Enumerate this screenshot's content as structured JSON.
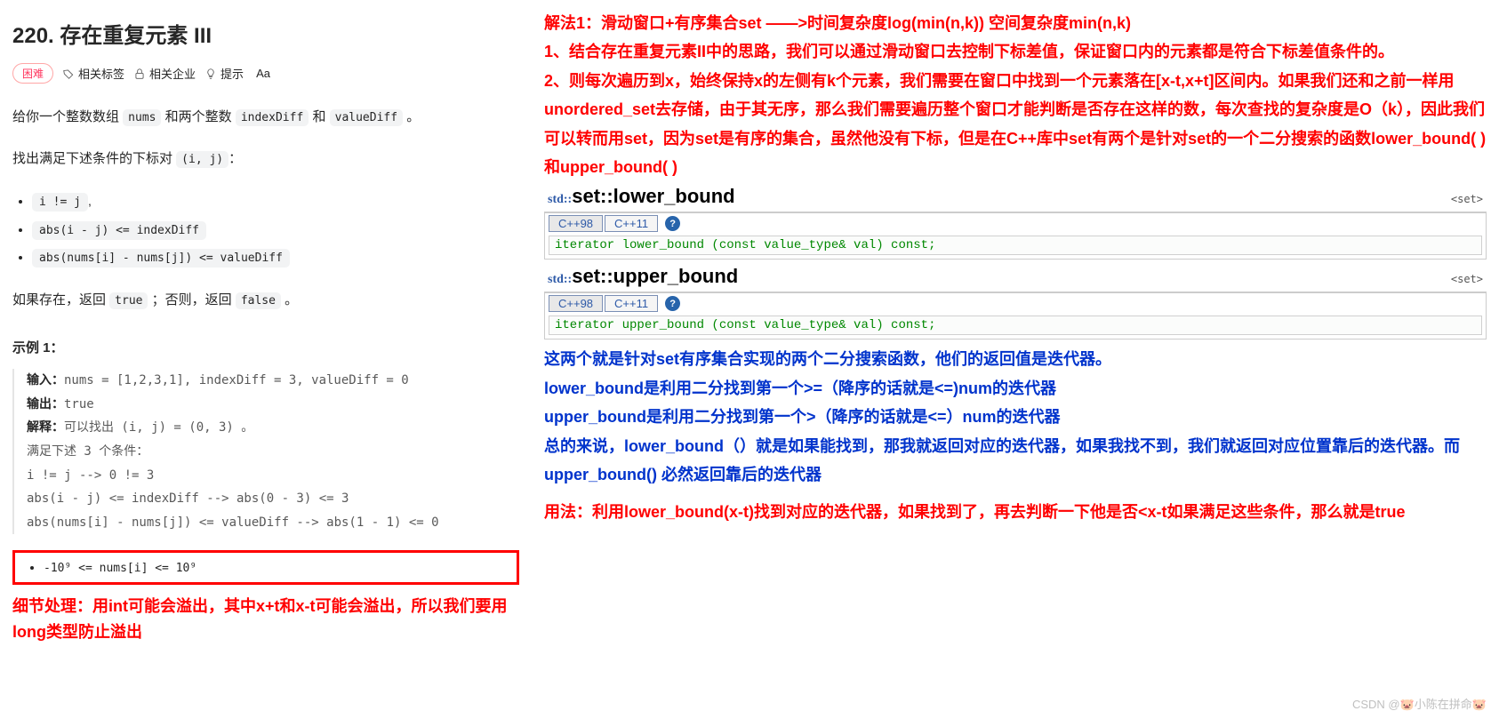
{
  "problem": {
    "title": "220. 存在重复元素 III",
    "difficulty": "困难",
    "meta": {
      "related_tags": "相关标签",
      "related_companies": "相关企业",
      "hint": "提示",
      "font_size": "Aa"
    },
    "desc_parts": {
      "p1_a": "给你一个整数数组 ",
      "nums": "nums",
      "p1_b": " 和两个整数 ",
      "indexDiff": "indexDiff",
      "p1_c": " 和 ",
      "valueDiff": "valueDiff",
      "p1_d": " 。",
      "p2_a": "找出满足下述条件的下标对 ",
      "ij": "(i, j)",
      "p2_b": "："
    },
    "conditions": {
      "c1": "i != j",
      "c1_tail": ",",
      "c2": "abs(i - j) <= indexDiff",
      "c3": "abs(nums[i] - nums[j]) <= valueDiff"
    },
    "return_line": {
      "a": "如果存在，返回 ",
      "true": "true",
      "b": " ；否则，返回 ",
      "false": "false",
      "c": " 。"
    },
    "example": {
      "heading": "示例 1：",
      "input_label": "输入：",
      "input": "nums = [1,2,3,1], indexDiff = 3, valueDiff = 0",
      "output_label": "输出：",
      "output": "true",
      "explain_label": "解释：",
      "explain_line1": "可以找出 (i, j) = (0, 3) 。",
      "explain_line2": "满足下述 3 个条件：",
      "explain_line3": "i != j --> 0 != 3",
      "explain_line4": "abs(i - j) <= indexDiff --> abs(0 - 3) <= 3",
      "explain_line5": "abs(nums[i] - nums[j]) <= valueDiff --> abs(1 - 1) <= 0"
    },
    "constraint": "-10⁹ <= nums[i] <= 10⁹",
    "detail_note": "细节处理：用int可能会溢出，其中x+t和x-t可能会溢出，所以我们要用long类型防止溢出"
  },
  "annotations": {
    "r1": "解法1：滑动窗口+有序集合set ——>时间复杂度log(min(n,k))    空间复杂度min(n,k)",
    "r2": "1、结合存在重复元素II中的思路，我们可以通过滑动窗口去控制下标差值，保证窗口内的元素都是符合下标差值条件的。",
    "r3": "2、则每次遍历到x，始终保持x的左侧有k个元素，我们需要在窗口中找到一个元素落在[x-t,x+t]区间内。如果我们还和之前一样用unordered_set去存储，由于其无序，那么我们需要遍历整个窗口才能判断是否存在这样的数，每次查找的复杂度是O（k），因此我们可以转而用set，因为set是有序的集合，虽然他没有下标，但是在C++库中set有两个是针对set的一个二分搜索的函数lower_bound( )和upper_bound( )",
    "b1": "这两个就是针对set有序集合实现的两个二分搜索函数，他们的返回值是迭代器。",
    "b2": "lower_bound是利用二分找到第一个>=（降序的话就是<=)num的迭代器",
    "b3": "upper_bound是利用二分找到第一个>（降序的话就是<=）num的迭代器",
    "b4": "总的来说，lower_bound（）就是如果能找到，那我就返回对应的迭代器，如果我找不到，我们就返回对应位置靠后的迭代器。而upper_bound()  必然返回靠后的迭代器",
    "r4": "用法：利用lower_bound(x-t)找到对应的迭代器，如果找到了，再去判断一下他是否<x-t如果满足这些条件，那么就是true"
  },
  "refs": {
    "lower": {
      "std": "std::",
      "name": "set::lower_bound",
      "tag": "<set>",
      "tab1": "C++98",
      "tab2": "C++11",
      "sig": "iterator lower_bound (const value_type& val) const;"
    },
    "upper": {
      "std": "std::",
      "name": "set::upper_bound",
      "tag": "<set>",
      "tab1": "C++98",
      "tab2": "C++11",
      "sig": "iterator upper_bound (const value_type& val) const;"
    }
  },
  "watermark": "CSDN @🐷小陈在拼命🐷"
}
